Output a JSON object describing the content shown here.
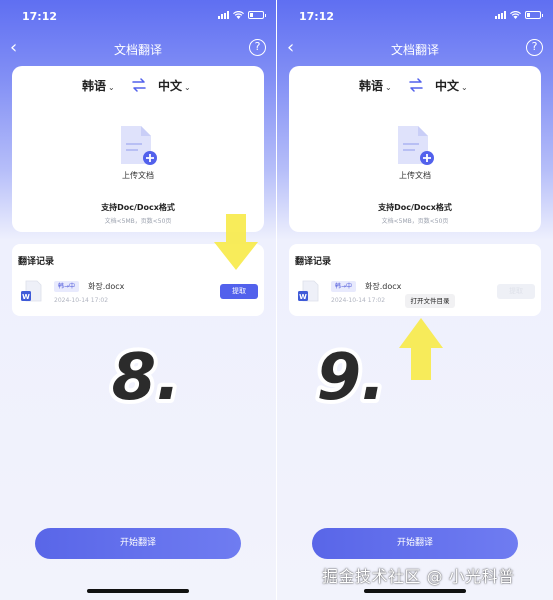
{
  "status": {
    "time": "17:12"
  },
  "nav": {
    "title": "文档翻译",
    "help_glyph": "?",
    "back_glyph": "‹"
  },
  "languages": {
    "source": "韩语",
    "target": "中文",
    "caret": "⌄"
  },
  "upload": {
    "label": "上传文档",
    "formats": "支持Doc/Docx格式",
    "limits": "文档<5MB，页数<50页"
  },
  "history": {
    "title": "翻译记录",
    "item": {
      "direction": "韩→中",
      "filename": "화장.docx",
      "date": "2024-10-14 17:02"
    },
    "extract_label": "提取",
    "open_dir_label": "打开文件目录"
  },
  "steps": {
    "left": "8.",
    "right": "9."
  },
  "start_button": "开始翻译",
  "watermark": "掘金技术社区 @ 小光科普",
  "colors": {
    "accent": "#5261ec",
    "arrow": "#f7ea4c",
    "badge_text": "#4a55d9"
  }
}
